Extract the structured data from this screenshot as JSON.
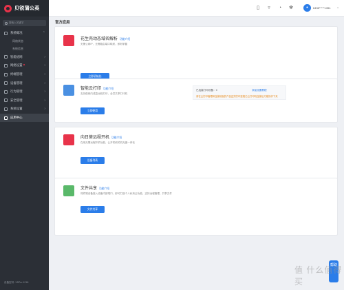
{
  "brand": {
    "name": "贝锐蒲公英"
  },
  "search": {
    "placeholder": "搜索入关键字"
  },
  "sidebar": {
    "items": [
      {
        "label": "系统概况",
        "expanded": true,
        "children": [
          "网络状态",
          "系统信息"
        ]
      },
      {
        "label": "智能组网"
      },
      {
        "label": "网络设置",
        "badge": true
      },
      {
        "label": "终端管理"
      },
      {
        "label": "设备管理"
      },
      {
        "label": "行为管理"
      },
      {
        "label": "安全管理"
      },
      {
        "label": "系统设置"
      },
      {
        "label": "应用中心",
        "active": true
      }
    ],
    "version": "设备型号: X5Pro 1218"
  },
  "header": {
    "account": "6498*****1351",
    "icons": [
      "phone-icon",
      "shirt-icon",
      "bell-icon",
      "gear-icon"
    ]
  },
  "main": {
    "section_title": "官方应用",
    "cards": [
      {
        "title": "花生壳动态域名解析",
        "func_link": "功能介绍",
        "desc": "无需公网IP，无需路由端口映射，即刻掌握",
        "button": "立即初始化",
        "icon": "peanut-shell-icon",
        "color": "#e8334a"
      },
      {
        "title": "智能云打印",
        "func_link": "功能介绍",
        "desc": "支持稳网内或高远程打印，全员共享打印机",
        "button": "立即使用",
        "icon": "cloud-print-icon",
        "color": "#4a90e2",
        "status": {
          "line1": "已连接打印设备：0",
          "link": "添加设置教程",
          "warn": "请在云打印管理和连接前面的产品还须打印进程已云打印机连接后方能操作下来"
        }
      },
      {
        "title": "向日葵远程开机",
        "func_link": "功能介绍",
        "desc": "在用无需远程开机功能，让开机和关机无缝一体化",
        "button": "设备列表",
        "icon": "sunflower-icon",
        "color": "#e8334a"
      },
      {
        "title": "文件共享",
        "func_link": "功能介绍",
        "desc": "将终端设备接入设备内部端口，即可打造个人私有云功能，支持远程管理、共享文件",
        "button": "文件共享",
        "icon": "file-share-icon",
        "color": "#5ab96a"
      }
    ]
  },
  "help": {
    "label": "帮助"
  },
  "watermark": {
    "text": "值 什么值得买"
  }
}
